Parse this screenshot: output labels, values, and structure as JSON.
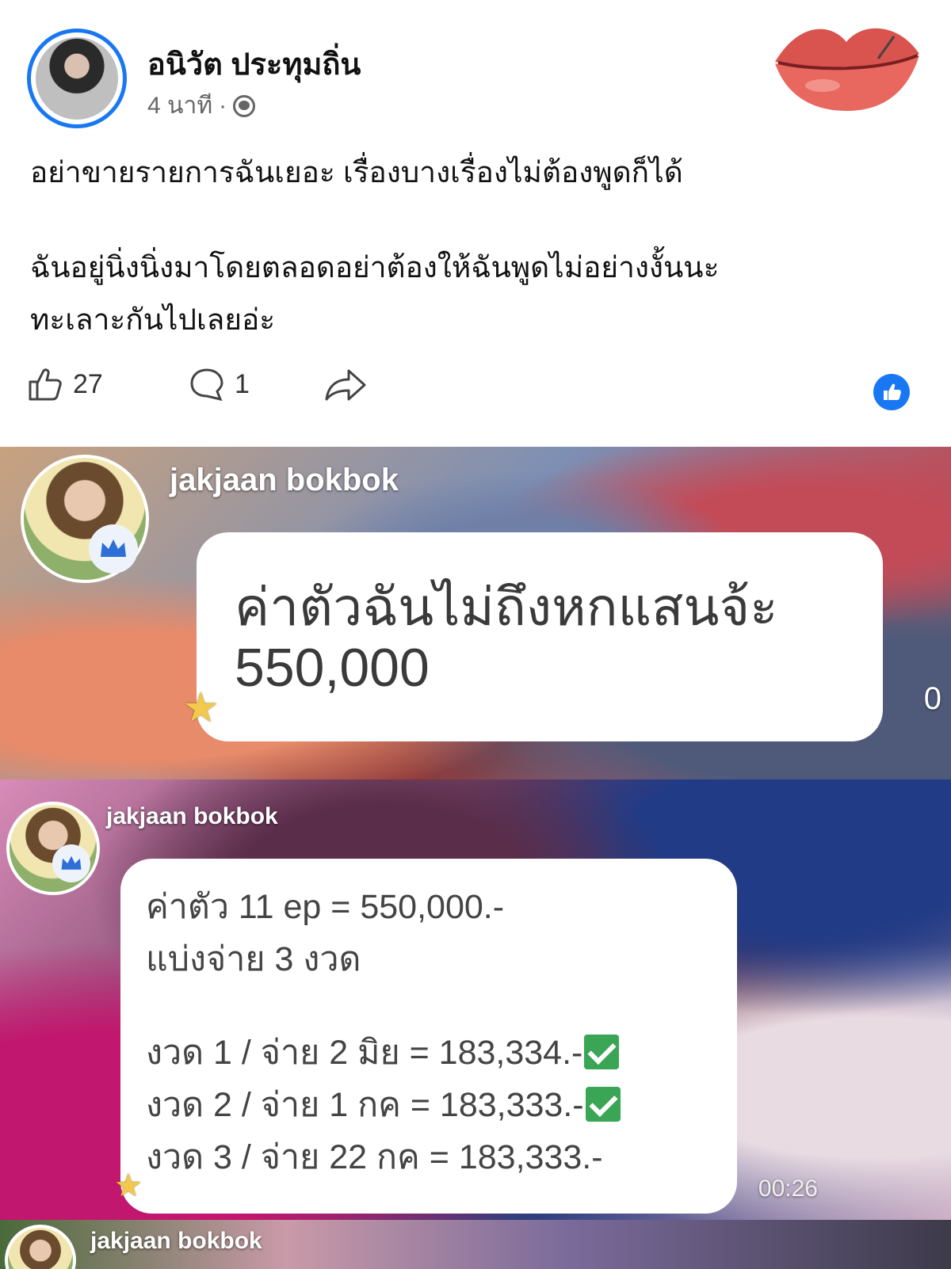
{
  "post": {
    "author": "อนิวัต ประทุมถิ่น",
    "time": "4 นาที",
    "separator": "·",
    "lines": [
      "อย่าขายรายการฉันเยอะ เรื่องบางเรื่องไม่ต้องพูดก็ได้",
      "ฉันอยู่นิ่งนิ่งมาโดยตลอดอย่าต้องให้ฉันพูดไม่อย่างงั้นนะ",
      "ทะเลาะกันไปเลยอ่ะ"
    ],
    "likes": "27",
    "comments": "1"
  },
  "chat1": {
    "username": "jakjaan bokbok",
    "line1": "ค่าตัวฉันไม่ถึงหกแสนจ้ะ",
    "line2": "550,000",
    "edge_text": "0"
  },
  "chat2": {
    "username": "jakjaan bokbok",
    "rows": [
      "ค่าตัว 11 ep = 550,000.-",
      "แบ่งจ่าย 3 งวด",
      "งวด 1 / จ่าย 2 มิย  = 183,334.-",
      "งวด 2 / จ่าย 1 กค  = 183,333.-",
      "งวด 3 / จ่าย 22 กค = 183,333.-"
    ],
    "timecode": "00:26"
  },
  "chat3": {
    "username": "jakjaan bokbok"
  },
  "colors": {
    "facebook_blue": "#1877f2",
    "check_green": "#3aa655",
    "star_yellow": "#f2c94c"
  },
  "icons": [
    "globe-icon",
    "like-icon",
    "comment-icon",
    "share-icon",
    "like-reaction-icon",
    "crown-icon",
    "star-icon",
    "check-icon"
  ]
}
